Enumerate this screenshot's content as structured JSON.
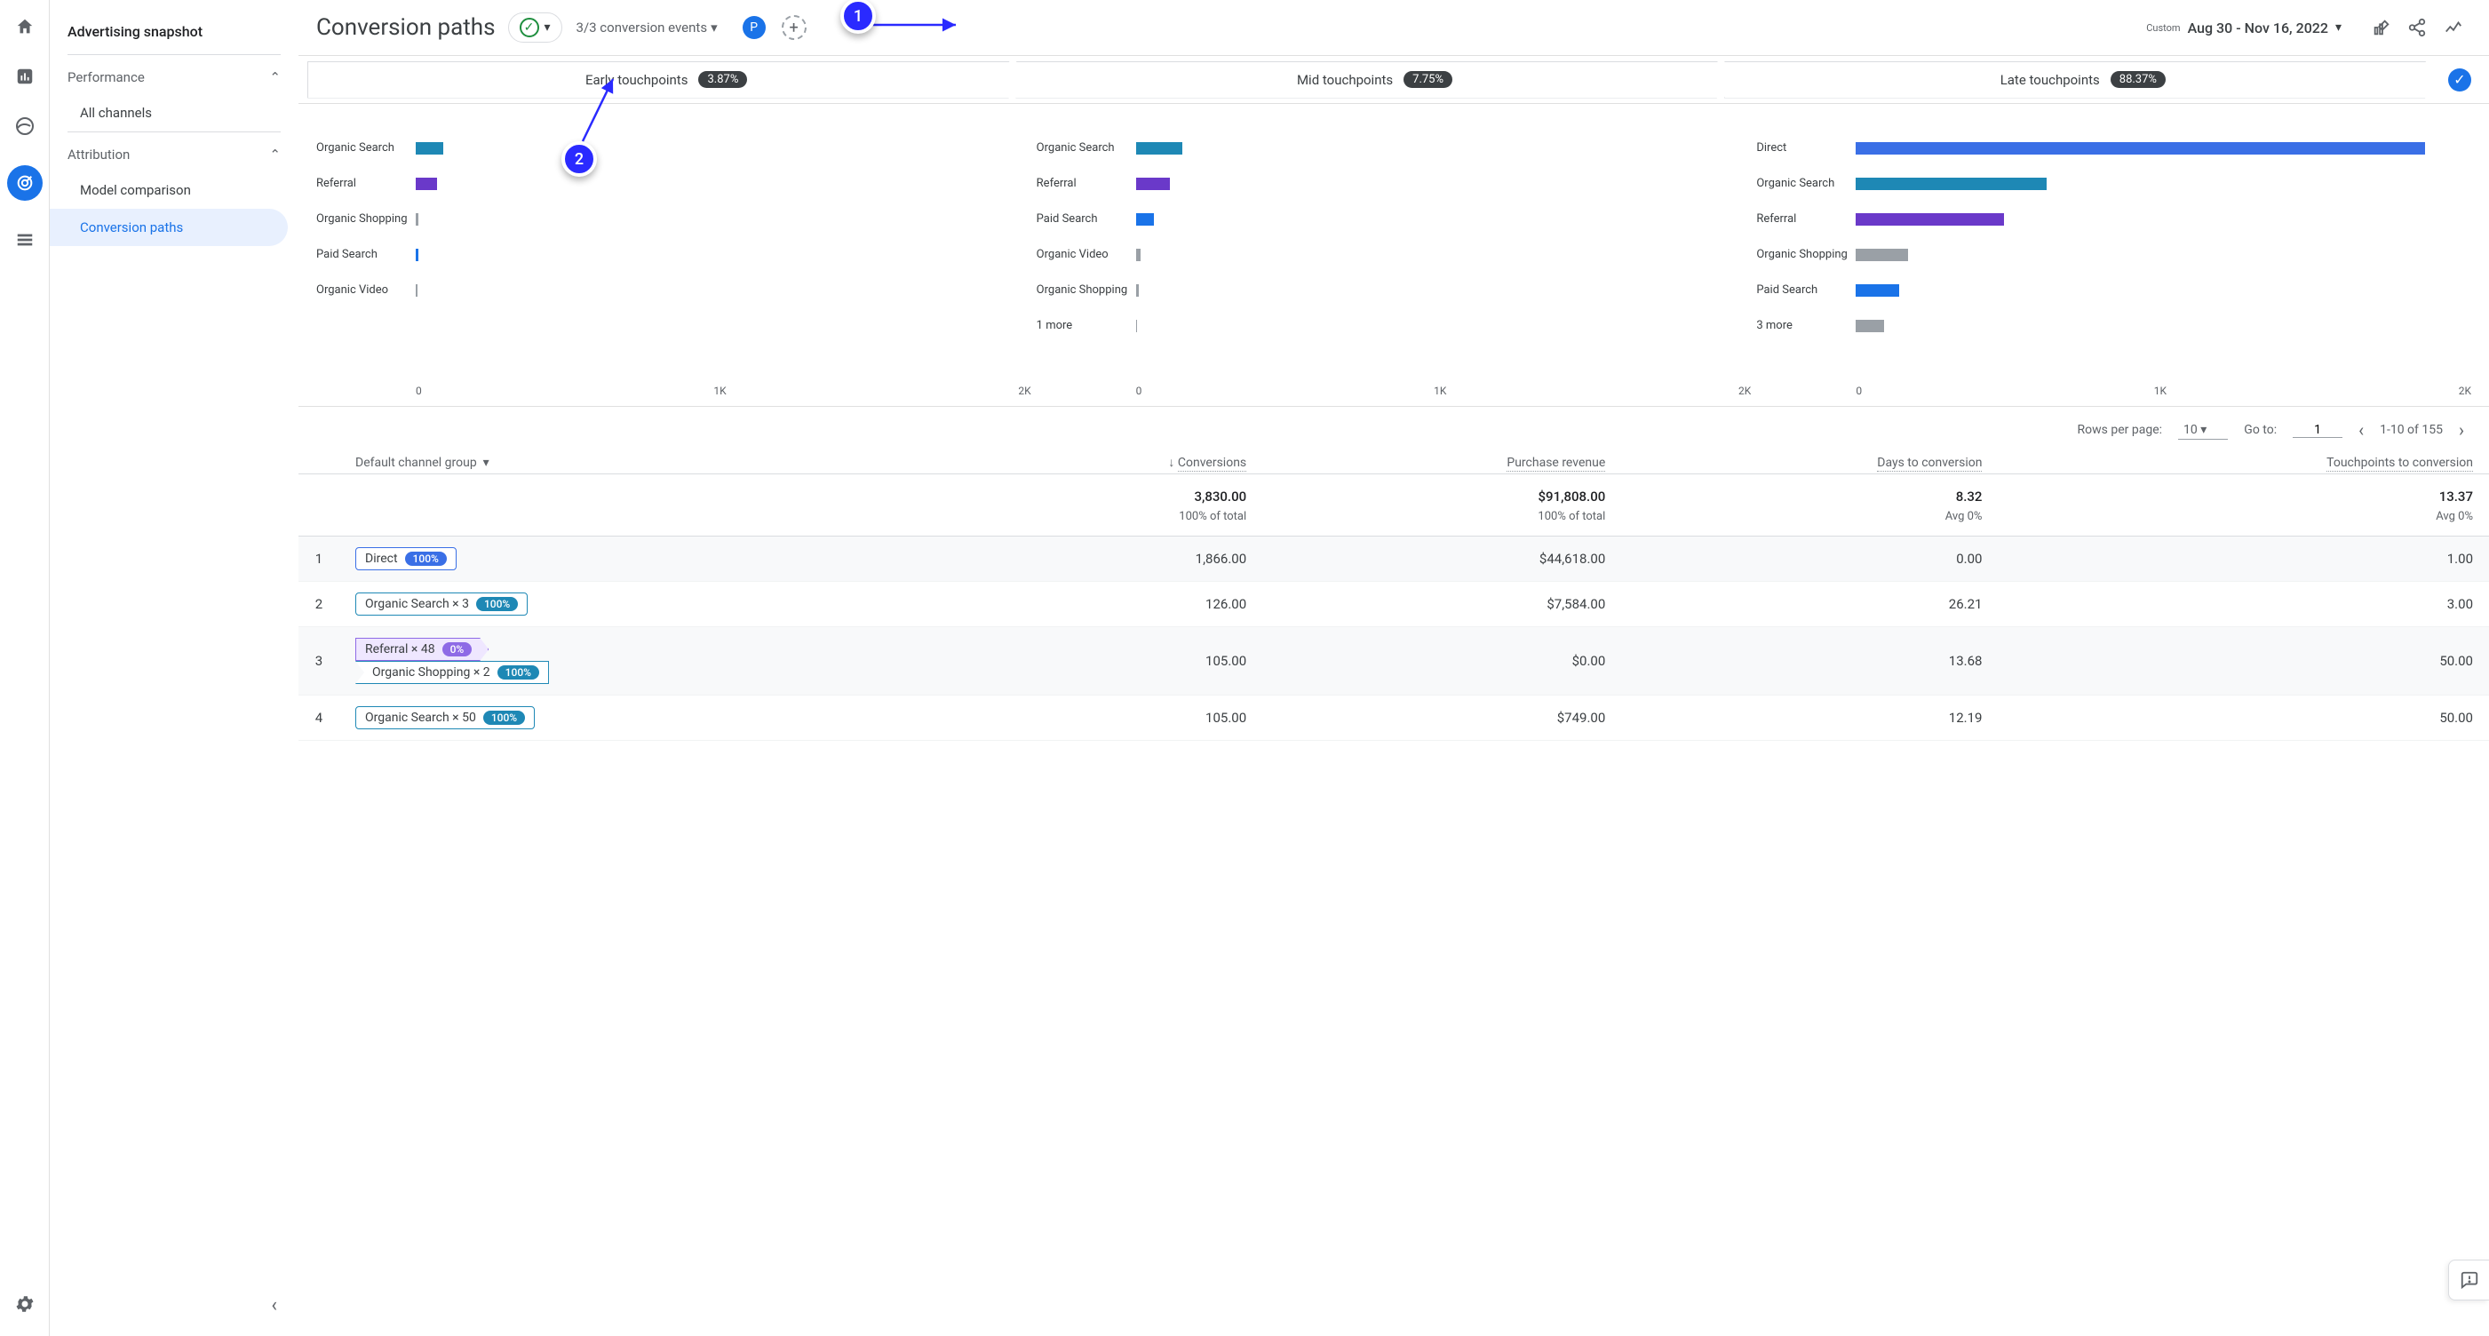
{
  "sidebar": {
    "title": "Advertising snapshot",
    "sections": [
      {
        "label": "Performance",
        "items": [
          {
            "label": "All channels"
          }
        ]
      },
      {
        "label": "Attribution",
        "items": [
          {
            "label": "Model comparison"
          },
          {
            "label": "Conversion paths",
            "selected": true
          }
        ]
      }
    ]
  },
  "header": {
    "title": "Conversion paths",
    "events_label": "3/3 conversion events",
    "filter_badge": "P",
    "custom_label": "Custom",
    "date_range": "Aug 30 - Nov 16, 2022"
  },
  "touchpoint_tabs": [
    {
      "label": "Early touchpoints",
      "pct": "3.87%"
    },
    {
      "label": "Mid touchpoints",
      "pct": "7.75%"
    },
    {
      "label": "Late touchpoints",
      "pct": "88.37%"
    }
  ],
  "chart_data": [
    {
      "type": "bar",
      "xlabel": "",
      "ylabel": "",
      "xlim": [
        0,
        2000
      ],
      "ticks": [
        "0",
        "1K",
        "2K"
      ],
      "series": [
        {
          "name": "Early",
          "values": [
            {
              "label": "Organic Search",
              "value": 90,
              "color": "c-os"
            },
            {
              "label": "Referral",
              "value": 70,
              "color": "c-ref"
            },
            {
              "label": "Organic Shopping",
              "value": 10,
              "color": "c-osh"
            },
            {
              "label": "Paid Search",
              "value": 8,
              "color": "c-ps"
            },
            {
              "label": "Organic Video",
              "value": 5,
              "color": "c-ov"
            }
          ]
        }
      ]
    },
    {
      "type": "bar",
      "xlim": [
        0,
        2000
      ],
      "ticks": [
        "0",
        "1K",
        "2K"
      ],
      "series": [
        {
          "name": "Mid",
          "values": [
            {
              "label": "Organic Search",
              "value": 150,
              "color": "c-os"
            },
            {
              "label": "Referral",
              "value": 110,
              "color": "c-ref"
            },
            {
              "label": "Paid Search",
              "value": 60,
              "color": "c-ps"
            },
            {
              "label": "Organic Video",
              "value": 15,
              "color": "c-ov"
            },
            {
              "label": "Organic Shopping",
              "value": 10,
              "color": "c-osh"
            },
            {
              "label": "1 more",
              "value": 5,
              "color": "c-osh"
            }
          ]
        }
      ]
    },
    {
      "type": "bar",
      "xlim": [
        0,
        2000
      ],
      "ticks": [
        "0",
        "1K",
        "2K"
      ],
      "series": [
        {
          "name": "Late",
          "values": [
            {
              "label": "Direct",
              "value": 1850,
              "color": "c-dir"
            },
            {
              "label": "Organic Search",
              "value": 620,
              "color": "c-os"
            },
            {
              "label": "Referral",
              "value": 480,
              "color": "c-ref"
            },
            {
              "label": "Organic Shopping",
              "value": 170,
              "color": "c-osh"
            },
            {
              "label": "Paid Search",
              "value": 140,
              "color": "c-ps"
            },
            {
              "label": "3 more",
              "value": 90,
              "color": "c-osh"
            }
          ]
        }
      ]
    }
  ],
  "table": {
    "controls": {
      "rows_per_page_label": "Rows per page:",
      "rows_per_page_value": "10",
      "goto_label": "Go to:",
      "goto_value": "1",
      "range_label": "1-10 of 155"
    },
    "dimension_label": "Default channel group",
    "headers": [
      "Conversions",
      "Purchase revenue",
      "Days to conversion",
      "Touchpoints to conversion"
    ],
    "totals": {
      "values": [
        "3,830.00",
        "$91,808.00",
        "8.32",
        "13.37"
      ],
      "subs": [
        "100% of total",
        "100% of total",
        "Avg 0%",
        "Avg 0%"
      ]
    },
    "rows": [
      {
        "idx": "1",
        "path": [
          {
            "label": "Direct",
            "pill": "100%",
            "cls": "chip-dir"
          }
        ],
        "cells": [
          "1,866.00",
          "$44,618.00",
          "0.00",
          "1.00"
        ]
      },
      {
        "idx": "2",
        "path": [
          {
            "label": "Organic Search × 3",
            "pill": "100%",
            "cls": "chip-os"
          }
        ],
        "cells": [
          "126.00",
          "$7,584.00",
          "26.21",
          "3.00"
        ]
      },
      {
        "idx": "3",
        "path": [
          {
            "label": "Referral × 48",
            "pill": "0%",
            "cls": "chip-ref",
            "shape": "chip-arrow"
          },
          {
            "label": "Organic Shopping × 2",
            "pill": "100%",
            "cls": "chip-osh",
            "shape": "chip-indent"
          }
        ],
        "cells": [
          "105.00",
          "$0.00",
          "13.68",
          "50.00"
        ]
      },
      {
        "idx": "4",
        "path": [
          {
            "label": "Organic Search × 50",
            "pill": "100%",
            "cls": "chip-os"
          }
        ],
        "cells": [
          "105.00",
          "$749.00",
          "12.19",
          "50.00"
        ]
      }
    ]
  },
  "annotations": {
    "a1": "1",
    "a2": "2"
  }
}
